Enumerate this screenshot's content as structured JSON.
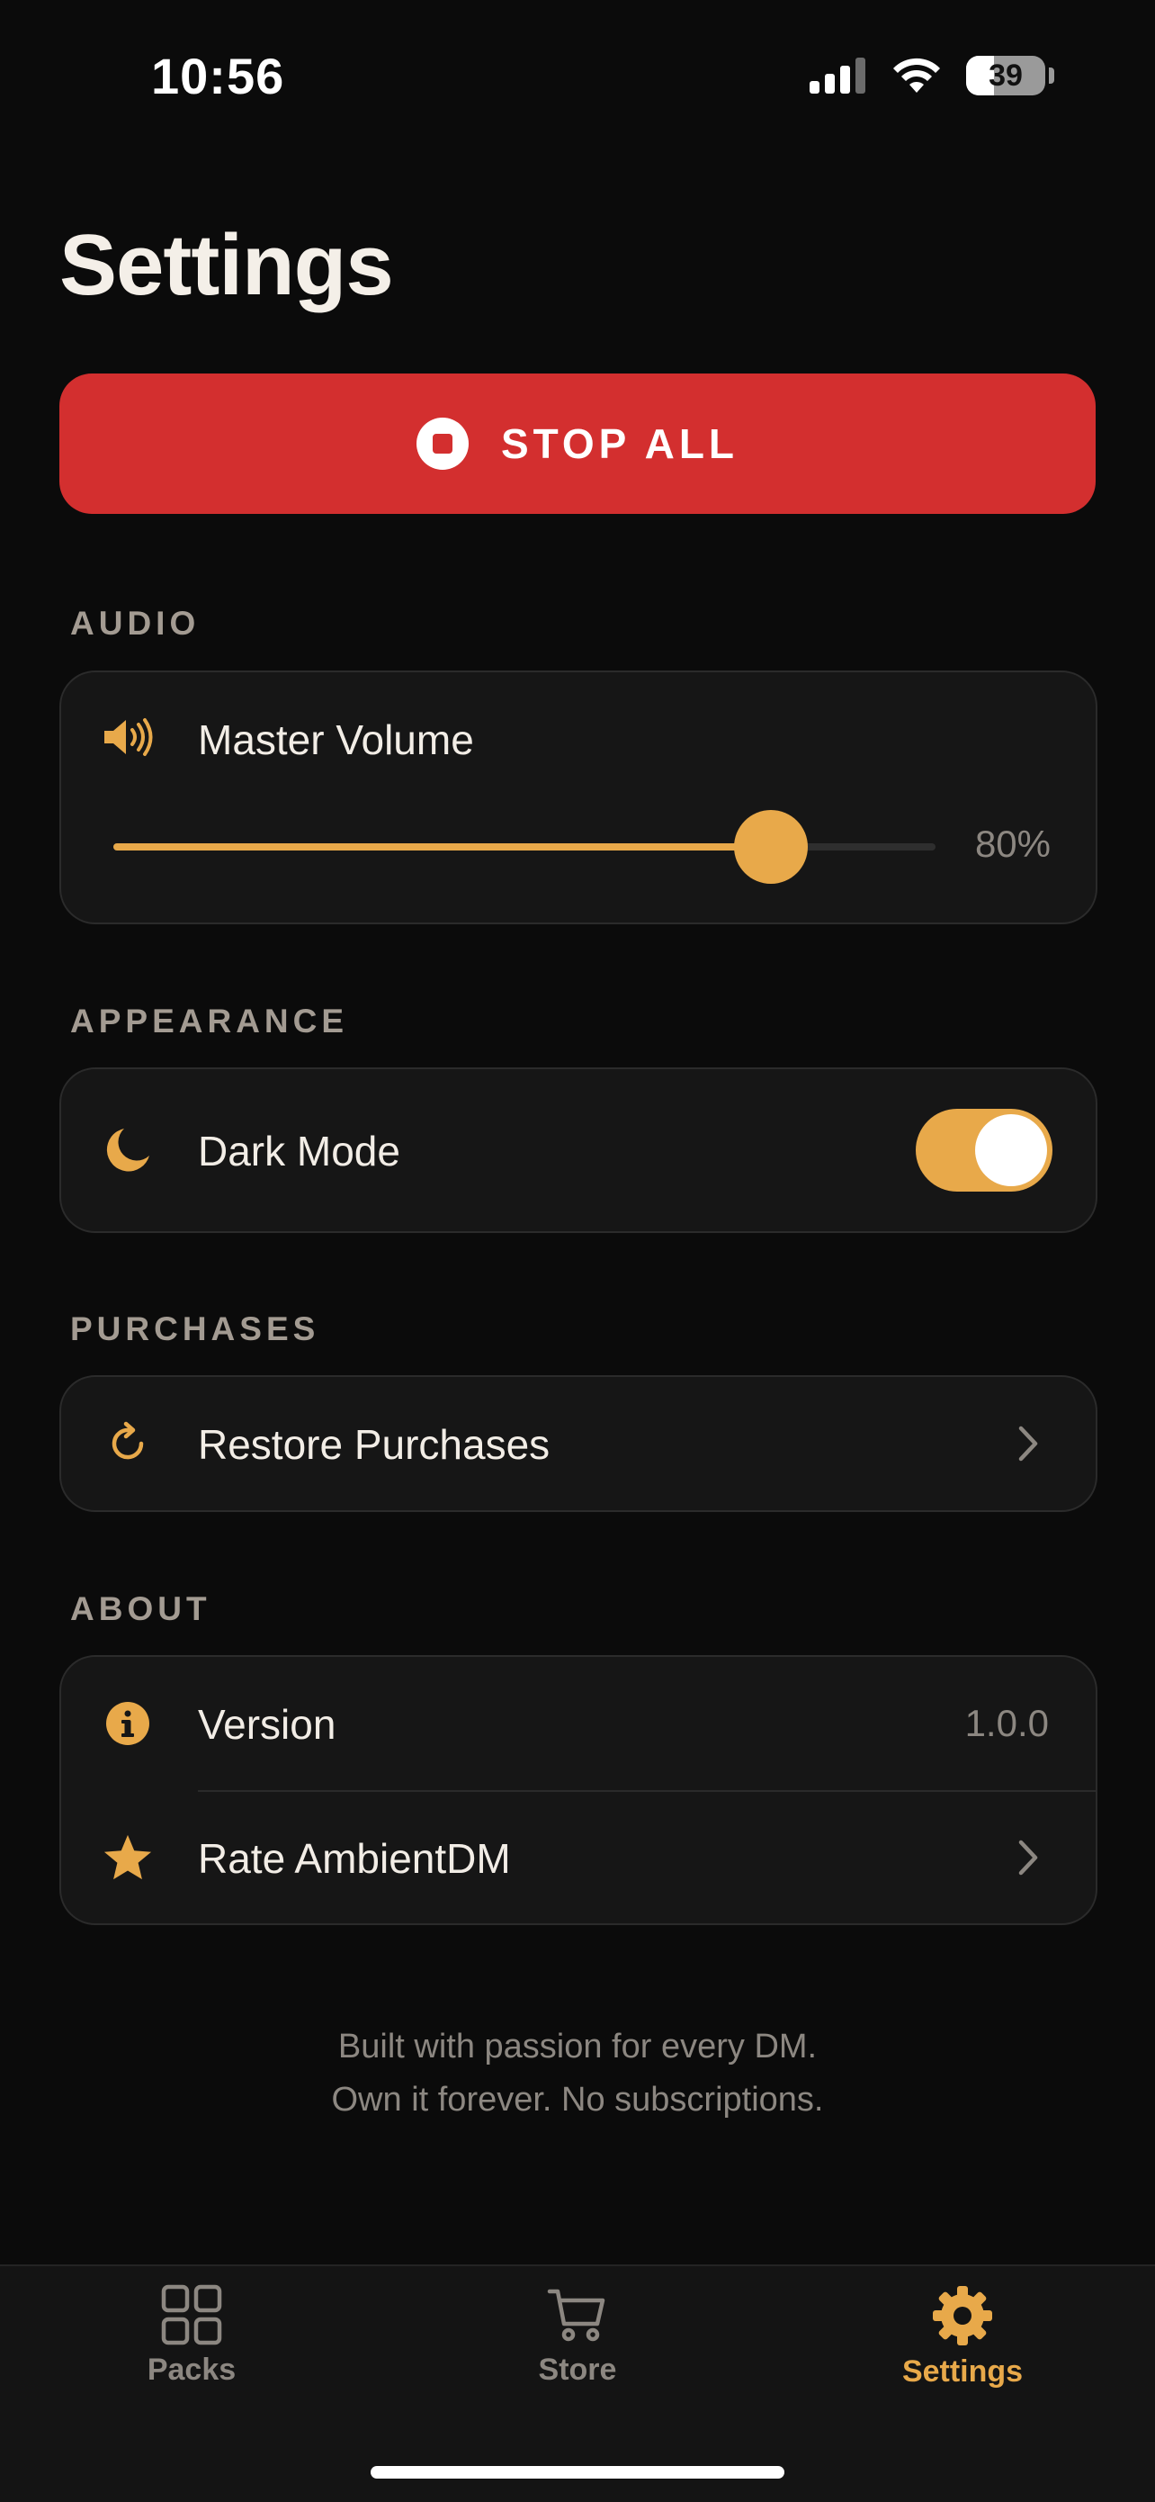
{
  "status_bar": {
    "time": "10:56",
    "battery": "39"
  },
  "page_title": "Settings",
  "stop_all": {
    "label": "STOP ALL"
  },
  "audio": {
    "section_label": "AUDIO",
    "master_volume": {
      "label": "Master Volume",
      "value": 80,
      "display": "80%"
    }
  },
  "appearance": {
    "section_label": "APPEARANCE",
    "dark_mode": {
      "label": "Dark Mode",
      "enabled": true
    }
  },
  "purchases": {
    "section_label": "PURCHASES",
    "restore": {
      "label": "Restore Purchases"
    }
  },
  "about": {
    "section_label": "ABOUT",
    "version": {
      "label": "Version",
      "value": "1.0.0"
    },
    "rate": {
      "label": "Rate AmbientDM"
    }
  },
  "footer": {
    "line1": "Built with passion for every DM.",
    "line2": "Own it forever. No subscriptions."
  },
  "tabs": [
    {
      "label": "Packs",
      "icon": "grid-icon",
      "active": false
    },
    {
      "label": "Store",
      "icon": "cart-icon",
      "active": false
    },
    {
      "label": "Settings",
      "icon": "gear-icon",
      "active": true
    }
  ],
  "colors": {
    "accent": "#e8a94a",
    "danger": "#d32f2f",
    "background": "#0b0b0b",
    "card": "#161616",
    "inactive": "#8c8781"
  }
}
